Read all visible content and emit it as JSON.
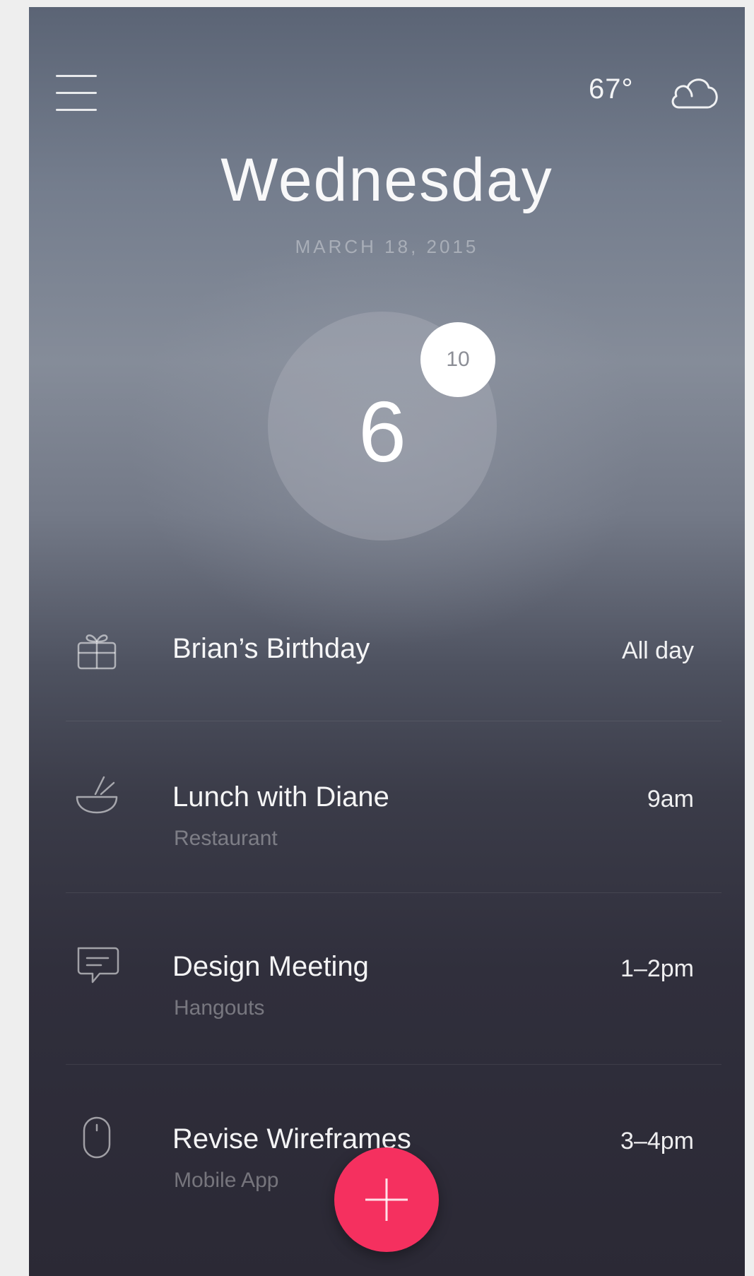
{
  "header": {
    "temperature": "67°",
    "weather_icon": "cloud-icon",
    "menu_icon": "hamburger-menu-icon"
  },
  "date": {
    "day": "Wednesday",
    "full_date": "MARCH 18, 2015"
  },
  "counter": {
    "events_today": "6",
    "badge": "10"
  },
  "events": [
    {
      "icon": "gift-icon",
      "title": "Brian’s Birthday",
      "subtitle": "",
      "time": "All day"
    },
    {
      "icon": "bowl-chopsticks-icon",
      "title": "Lunch with Diane",
      "subtitle": "Restaurant",
      "time": "9am"
    },
    {
      "icon": "chat-bubble-icon",
      "title": "Design Meeting",
      "subtitle": "Hangouts",
      "time": "1–2pm"
    },
    {
      "icon": "mouse-icon",
      "title": "Revise Wireframes",
      "subtitle": "Mobile App",
      "time": "3–4pm"
    }
  ],
  "fab": {
    "icon": "plus-icon"
  },
  "colors": {
    "accent": "#f5305f",
    "background_top": "#5b6475",
    "background_bottom": "#2b2935"
  }
}
